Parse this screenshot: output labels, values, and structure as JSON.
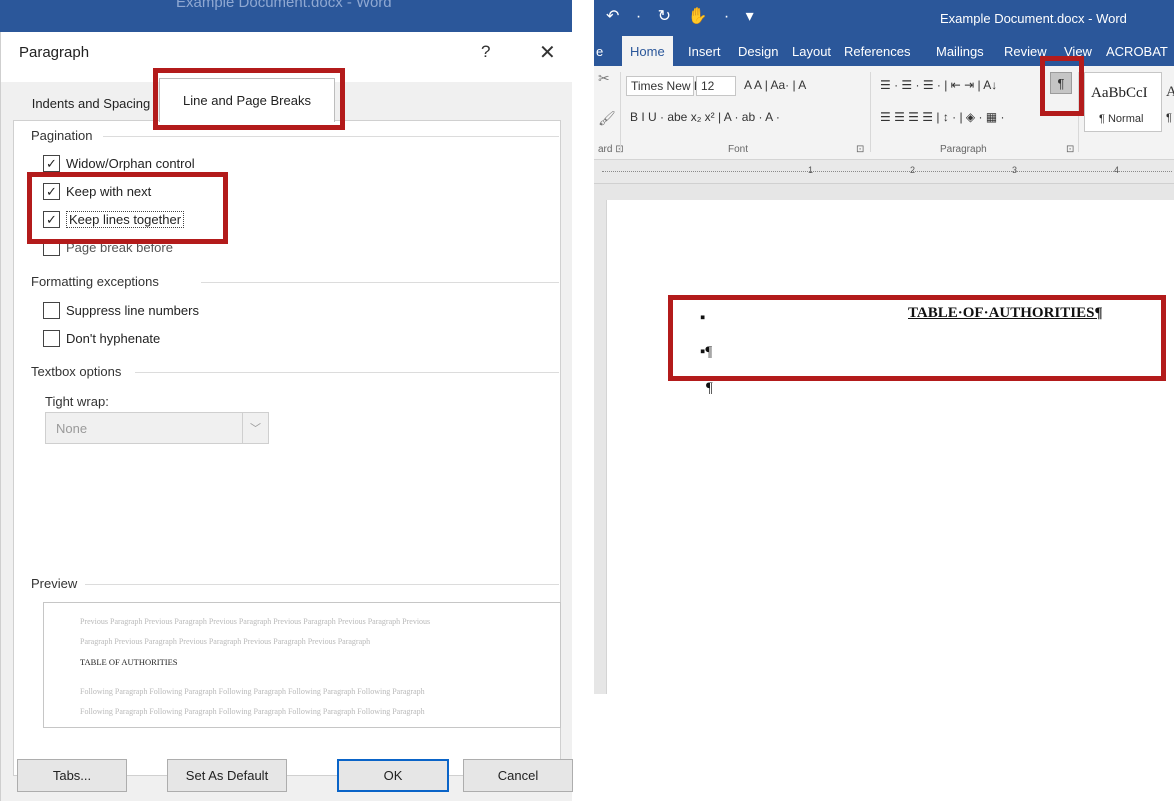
{
  "background_window": {
    "title": "Example Document.docx - Word"
  },
  "dialog": {
    "title": "Paragraph",
    "help_label": "?",
    "close_label": "✕",
    "tabs": [
      {
        "label": "Indents and Spacing"
      },
      {
        "label": "Line and Page Breaks"
      }
    ],
    "sections": {
      "pagination": "Pagination",
      "formatting_exceptions": "Formatting exceptions",
      "textbox_options": "Textbox options",
      "preview": "Preview"
    },
    "pagination_options": [
      {
        "label": "Widow/Orphan control",
        "checked": "✓"
      },
      {
        "label": "Keep with next",
        "checked": "✓"
      },
      {
        "label": "Keep lines together",
        "checked": "✓"
      },
      {
        "label": "Page break before",
        "checked": ""
      }
    ],
    "formatting_options": [
      {
        "label": "Suppress line numbers",
        "checked": ""
      },
      {
        "label": "Don't hyphenate",
        "checked": ""
      }
    ],
    "tight_wrap": {
      "label": "Tight wrap:",
      "value": "None"
    },
    "preview_text": {
      "previous_1": "Previous Paragraph Previous Paragraph Previous Paragraph Previous Paragraph Previous Paragraph Previous",
      "previous_2": "Paragraph Previous Paragraph Previous Paragraph Previous Paragraph Previous Paragraph",
      "current": "TABLE OF AUTHORITIES",
      "following_1": "Following Paragraph Following Paragraph Following Paragraph Following Paragraph Following Paragraph",
      "following_2": "Following Paragraph Following Paragraph Following Paragraph Following Paragraph Following Paragraph"
    },
    "buttons": {
      "tabs": "Tabs...",
      "set_default": "Set As Default",
      "ok": "OK",
      "cancel": "Cancel"
    }
  },
  "word": {
    "title": "Example Document.docx - Word",
    "quick_access": "↶ · ↻  ✋ · ▾",
    "ribbon_tabs": [
      "e",
      "Home",
      "Insert",
      "Design",
      "Layout",
      "References",
      "Mailings",
      "Review",
      "View",
      "ACROBAT"
    ],
    "font_name": "Times New R",
    "font_size": "12",
    "font_controls_row1": "A A | Aa· | A",
    "font_controls_row2": "B I U · abe x₂ x² | A · ab · A ·",
    "paragraph_row1": "☰ · ☰ · ☰ · | ⇤ ⇥ | A↓",
    "paragraph_row2": "☰ ☰ ☰ ☰ | ↕ · | ◈ · ▦ ·",
    "show_hide_label": "¶",
    "style_sample": "AaBbCcI",
    "style_sample_next": "A",
    "style_name": "¶ Normal",
    "style_name_next": "¶",
    "groups": {
      "clipboard": "ard ⊡",
      "font": "Font",
      "font_launcher": "⊡",
      "paragraph": "Paragraph",
      "paragraph_launcher": "⊡"
    },
    "ruler_numbers": [
      "1",
      "2",
      "3",
      "4"
    ],
    "document": {
      "heading": "TABLE·OF·AUTHORITIES¶",
      "bullet_1": "▪",
      "bullet_2": "▪¶",
      "cursor_mark": "¶"
    }
  },
  "colors": {
    "word_blue": "#2b579a",
    "highlight_red": "#b31b1b",
    "ok_focus": "#0a64c8"
  }
}
